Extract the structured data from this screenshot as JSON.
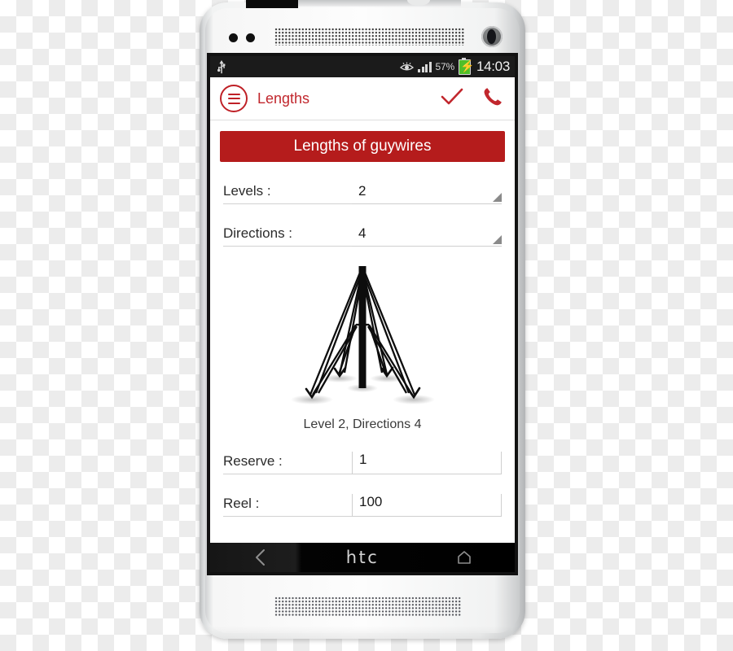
{
  "device": {
    "brand_logo": "htc",
    "nav": {
      "back_icon": "back-chevron-icon",
      "home_icon": "home-icon"
    }
  },
  "statusbar": {
    "usb_icon": "usb-icon",
    "eye_icon": "eye-icon",
    "signal_icon": "signal-bars-icon",
    "battery_percent": "57%",
    "battery_icon": "battery-charging-icon",
    "clock": "14:03"
  },
  "appbar": {
    "menu_icon": "hamburger-menu-icon",
    "title": "Lengths",
    "confirm_icon": "check-icon",
    "call_icon": "phone-call-icon",
    "accent_color": "#c1272d"
  },
  "main": {
    "banner": {
      "text": "Lengths of guywires",
      "background_color": "#b51c1c"
    },
    "fields": [
      {
        "label": "Levels :",
        "value": "2",
        "control": "spinner"
      },
      {
        "label": "Directions :",
        "value": "4",
        "control": "spinner"
      },
      {
        "label": "Reserve :",
        "value": "1",
        "control": "edit-text"
      },
      {
        "label": "Reel :",
        "value": "100",
        "control": "edit-text"
      }
    ],
    "figure": {
      "name": "guywire-tower-diagram",
      "caption": "Level 2, Directions 4"
    }
  }
}
